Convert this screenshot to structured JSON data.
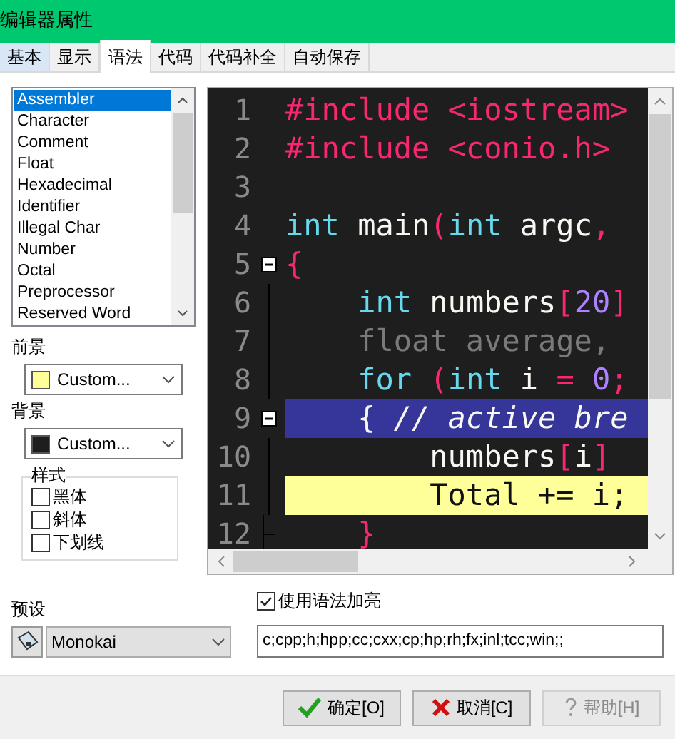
{
  "window": {
    "title": "编辑器属性"
  },
  "tabs": [
    {
      "label": "基本",
      "selected": false,
      "hover": true
    },
    {
      "label": "显示",
      "selected": false
    },
    {
      "label": "语法",
      "selected": true
    },
    {
      "label": "代码",
      "selected": false
    },
    {
      "label": "代码补全",
      "selected": false
    },
    {
      "label": "自动保存",
      "selected": false
    }
  ],
  "elements": [
    {
      "label": "Assembler",
      "selected": true
    },
    {
      "label": "Character",
      "selected": false
    },
    {
      "label": "Comment",
      "selected": false
    },
    {
      "label": "Float",
      "selected": false
    },
    {
      "label": "Hexadecimal",
      "selected": false
    },
    {
      "label": "Identifier",
      "selected": false
    },
    {
      "label": "Illegal Char",
      "selected": false
    },
    {
      "label": "Number",
      "selected": false
    },
    {
      "label": "Octal",
      "selected": false
    },
    {
      "label": "Preprocessor",
      "selected": false
    },
    {
      "label": "Reserved Word",
      "selected": false
    }
  ],
  "foreground": {
    "label": "前景",
    "value": "Custom...",
    "color": "#ffff99"
  },
  "background": {
    "label": "背景",
    "value": "Custom...",
    "color": "#1e1e1e"
  },
  "style_group": {
    "title": "样式",
    "options": [
      {
        "label": "黑体",
        "checked": false
      },
      {
        "label": "斜体",
        "checked": false
      },
      {
        "label": "下划线",
        "checked": false
      }
    ]
  },
  "editor": {
    "lines": [
      {
        "number": "1",
        "fold_marker": false,
        "fold_guide": false,
        "fold_end": false,
        "breakpoint": false,
        "highlighted": false,
        "tokens": [
          {
            "text": "#include <iostream>",
            "kind": "preproc"
          }
        ]
      },
      {
        "number": "2",
        "fold_marker": false,
        "fold_guide": false,
        "fold_end": false,
        "breakpoint": false,
        "highlighted": false,
        "tokens": [
          {
            "text": "#include <conio.h>",
            "kind": "preproc"
          }
        ]
      },
      {
        "number": "3",
        "fold_marker": false,
        "fold_guide": false,
        "fold_end": false,
        "breakpoint": false,
        "highlighted": false
      },
      {
        "number": "4",
        "fold_marker": false,
        "fold_guide": false,
        "fold_end": false,
        "breakpoint": false,
        "highlighted": false,
        "tokens": [
          {
            "text": "int",
            "kind": "keyword"
          },
          {
            "text": " main",
            "kind": "ident"
          },
          {
            "text": "(",
            "kind": "symbol"
          },
          {
            "text": "int",
            "kind": "keyword"
          },
          {
            "text": " argc",
            "kind": "ident"
          },
          {
            "text": ",",
            "kind": "symbol"
          }
        ]
      },
      {
        "number": "5",
        "fold_marker": true,
        "fold_guide": false,
        "fold_end": false,
        "breakpoint": false,
        "highlighted": false,
        "tokens": [
          {
            "text": "{",
            "kind": "symbol"
          }
        ]
      },
      {
        "number": "6",
        "fold_marker": false,
        "fold_guide": true,
        "fold_end": false,
        "breakpoint": false,
        "highlighted": false,
        "tokens": [
          {
            "text": "    int",
            "kind": "keyword"
          },
          {
            "text": " numbers",
            "kind": "ident"
          },
          {
            "text": "[",
            "kind": "symbol"
          },
          {
            "text": "20",
            "kind": "number"
          },
          {
            "text": "]",
            "kind": "symbol"
          }
        ]
      },
      {
        "number": "7",
        "fold_marker": false,
        "fold_guide": true,
        "fold_end": false,
        "breakpoint": false,
        "highlighted": false,
        "tokens": [
          {
            "text": "    float average,",
            "kind": "float"
          }
        ]
      },
      {
        "number": "8",
        "fold_marker": false,
        "fold_guide": true,
        "fold_end": false,
        "breakpoint": false,
        "highlighted": false,
        "tokens": [
          {
            "text": "    for",
            "kind": "keyword"
          },
          {
            "text": " (",
            "kind": "symbol"
          },
          {
            "text": "int",
            "kind": "keyword"
          },
          {
            "text": " i ",
            "kind": "ident"
          },
          {
            "text": "=",
            "kind": "symbol"
          },
          {
            "text": " 0",
            "kind": "number"
          },
          {
            "text": ";",
            "kind": "symbol"
          }
        ]
      },
      {
        "number": "9",
        "fold_marker": true,
        "fold_guide": false,
        "fold_end": false,
        "breakpoint": true,
        "highlighted": false,
        "tokens": [
          {
            "text": "    { ",
            "kind": "ident"
          },
          {
            "text": "// active bre",
            "kind": "comment"
          }
        ]
      },
      {
        "number": "10",
        "fold_marker": false,
        "fold_guide": true,
        "fold_end": false,
        "breakpoint": false,
        "highlighted": false,
        "tokens": [
          {
            "text": "        numbers",
            "kind": "ident"
          },
          {
            "text": "[",
            "kind": "symbol"
          },
          {
            "text": "i",
            "kind": "ident"
          },
          {
            "text": "]",
            "kind": "symbol"
          }
        ]
      },
      {
        "number": "11",
        "fold_marker": false,
        "fold_guide": true,
        "fold_end": false,
        "breakpoint": false,
        "highlighted": true,
        "tokens": [
          {
            "text": "        Total += i;",
            "kind": "ident"
          }
        ]
      },
      {
        "number": "12",
        "fold_marker": false,
        "fold_guide": false,
        "fold_end": true,
        "breakpoint": false,
        "highlighted": false,
        "tokens": [
          {
            "text": "    }",
            "kind": "symbol"
          }
        ]
      }
    ]
  },
  "preset": {
    "label": "预设",
    "value": "Monokai"
  },
  "syntax_highlight": {
    "label": "使用语法加亮",
    "checked": true
  },
  "extensions": {
    "value": "c;cpp;h;hpp;cc;cxx;cp;hp;rh;fx;inl;tcc;win;;"
  },
  "buttons": [
    {
      "label": "确定[O]",
      "kind": "ok",
      "disabled": false
    },
    {
      "label": "取消[C]",
      "kind": "cancel",
      "disabled": false
    },
    {
      "label": "帮助[H]",
      "kind": "help",
      "disabled": true
    }
  ]
}
